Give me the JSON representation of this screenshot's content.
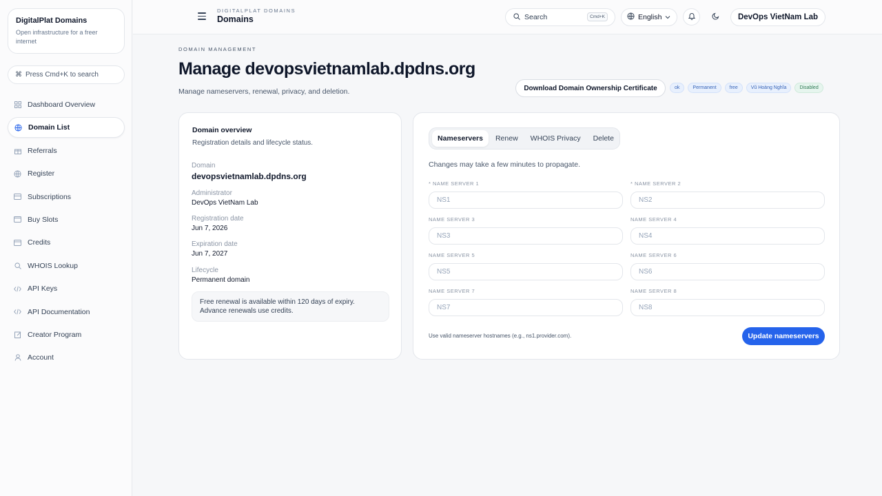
{
  "sidebar": {
    "brand_name": "DigitalPlat Domains",
    "brand_tagline": "Open infrastructure for a freer internet",
    "search_placeholder": "Press Cmd+K to search",
    "items": [
      {
        "label": "Dashboard Overview",
        "icon": "grid-icon",
        "active": false
      },
      {
        "label": "Domain List",
        "icon": "globe-icon",
        "active": true
      },
      {
        "label": "Referrals",
        "icon": "gift-icon",
        "active": false
      },
      {
        "label": "Register",
        "icon": "globe-icon",
        "active": false
      },
      {
        "label": "Subscriptions",
        "icon": "card-icon",
        "active": false
      },
      {
        "label": "Buy Slots",
        "icon": "wallet-icon",
        "active": false
      },
      {
        "label": "Credits",
        "icon": "credit-card-icon",
        "active": false
      },
      {
        "label": "WHOIS Lookup",
        "icon": "search-icon",
        "active": false
      },
      {
        "label": "API Keys",
        "icon": "code-icon",
        "active": false
      },
      {
        "label": "API Documentation",
        "icon": "code-icon",
        "active": false
      },
      {
        "label": "Creator Program",
        "icon": "edit-icon",
        "active": false
      },
      {
        "label": "Account",
        "icon": "user-icon",
        "active": false
      }
    ]
  },
  "topbar": {
    "kicker": "DIGITALPLAT DOMAINS",
    "title": "Domains",
    "search_label": "Search",
    "search_kbd": "Cmd+K",
    "language": "English",
    "user": "DevOps VietNam Lab"
  },
  "header": {
    "kicker": "DOMAIN MANAGEMENT",
    "title": "Manage devopsvietnamlab.dpdns.org",
    "subtitle": "Manage nameservers, renewal, privacy, and deletion.",
    "cert_button": "Download Domain Ownership Certificate",
    "badges": [
      "ok",
      "Permanent",
      "free",
      "Vũ Hoàng Nghĩa",
      "Disabled"
    ]
  },
  "overview": {
    "title": "Domain overview",
    "subtitle": "Registration details and lifecycle status.",
    "fields": [
      {
        "label": "Domain",
        "value": "devopsvietnamlab.dpdns.org"
      },
      {
        "label": "Administrator",
        "value": "DevOps VietNam Lab"
      },
      {
        "label": "Registration date",
        "value": "Jun 7, 2026"
      },
      {
        "label": "Expiration date",
        "value": "Jun 7, 2027"
      },
      {
        "label": "Lifecycle",
        "value": "Permanent domain"
      }
    ],
    "note_line1": "Free renewal is available within 120 days of expiry.",
    "note_line2": "Advance renewals use credits."
  },
  "nameservers": {
    "tabs": [
      "Nameservers",
      "Renew",
      "WHOIS Privacy",
      "Delete"
    ],
    "active_tab": "Nameservers",
    "propagate_note": "Changes may take a few minutes to propagate.",
    "fields": [
      {
        "label": "* NAME SERVER 1",
        "placeholder": "NS1",
        "value": ""
      },
      {
        "label": "* NAME SERVER 2",
        "placeholder": "NS2",
        "value": ""
      },
      {
        "label": "NAME SERVER 3",
        "placeholder": "NS3",
        "value": ""
      },
      {
        "label": "NAME SERVER 4",
        "placeholder": "NS4",
        "value": ""
      },
      {
        "label": "NAME SERVER 5",
        "placeholder": "NS5",
        "value": ""
      },
      {
        "label": "NAME SERVER 6",
        "placeholder": "NS6",
        "value": ""
      },
      {
        "label": "NAME SERVER 7",
        "placeholder": "NS7",
        "value": ""
      },
      {
        "label": "NAME SERVER 8",
        "placeholder": "NS8",
        "value": ""
      }
    ],
    "hint": "Use valid nameserver hostnames (e.g., ns1.provider.com).",
    "submit_label": "Update nameservers"
  },
  "colors": {
    "accent": "#2563eb",
    "badge_blue_bg": "#e8f0fd",
    "badge_green_bg": "#e6f5ee"
  }
}
